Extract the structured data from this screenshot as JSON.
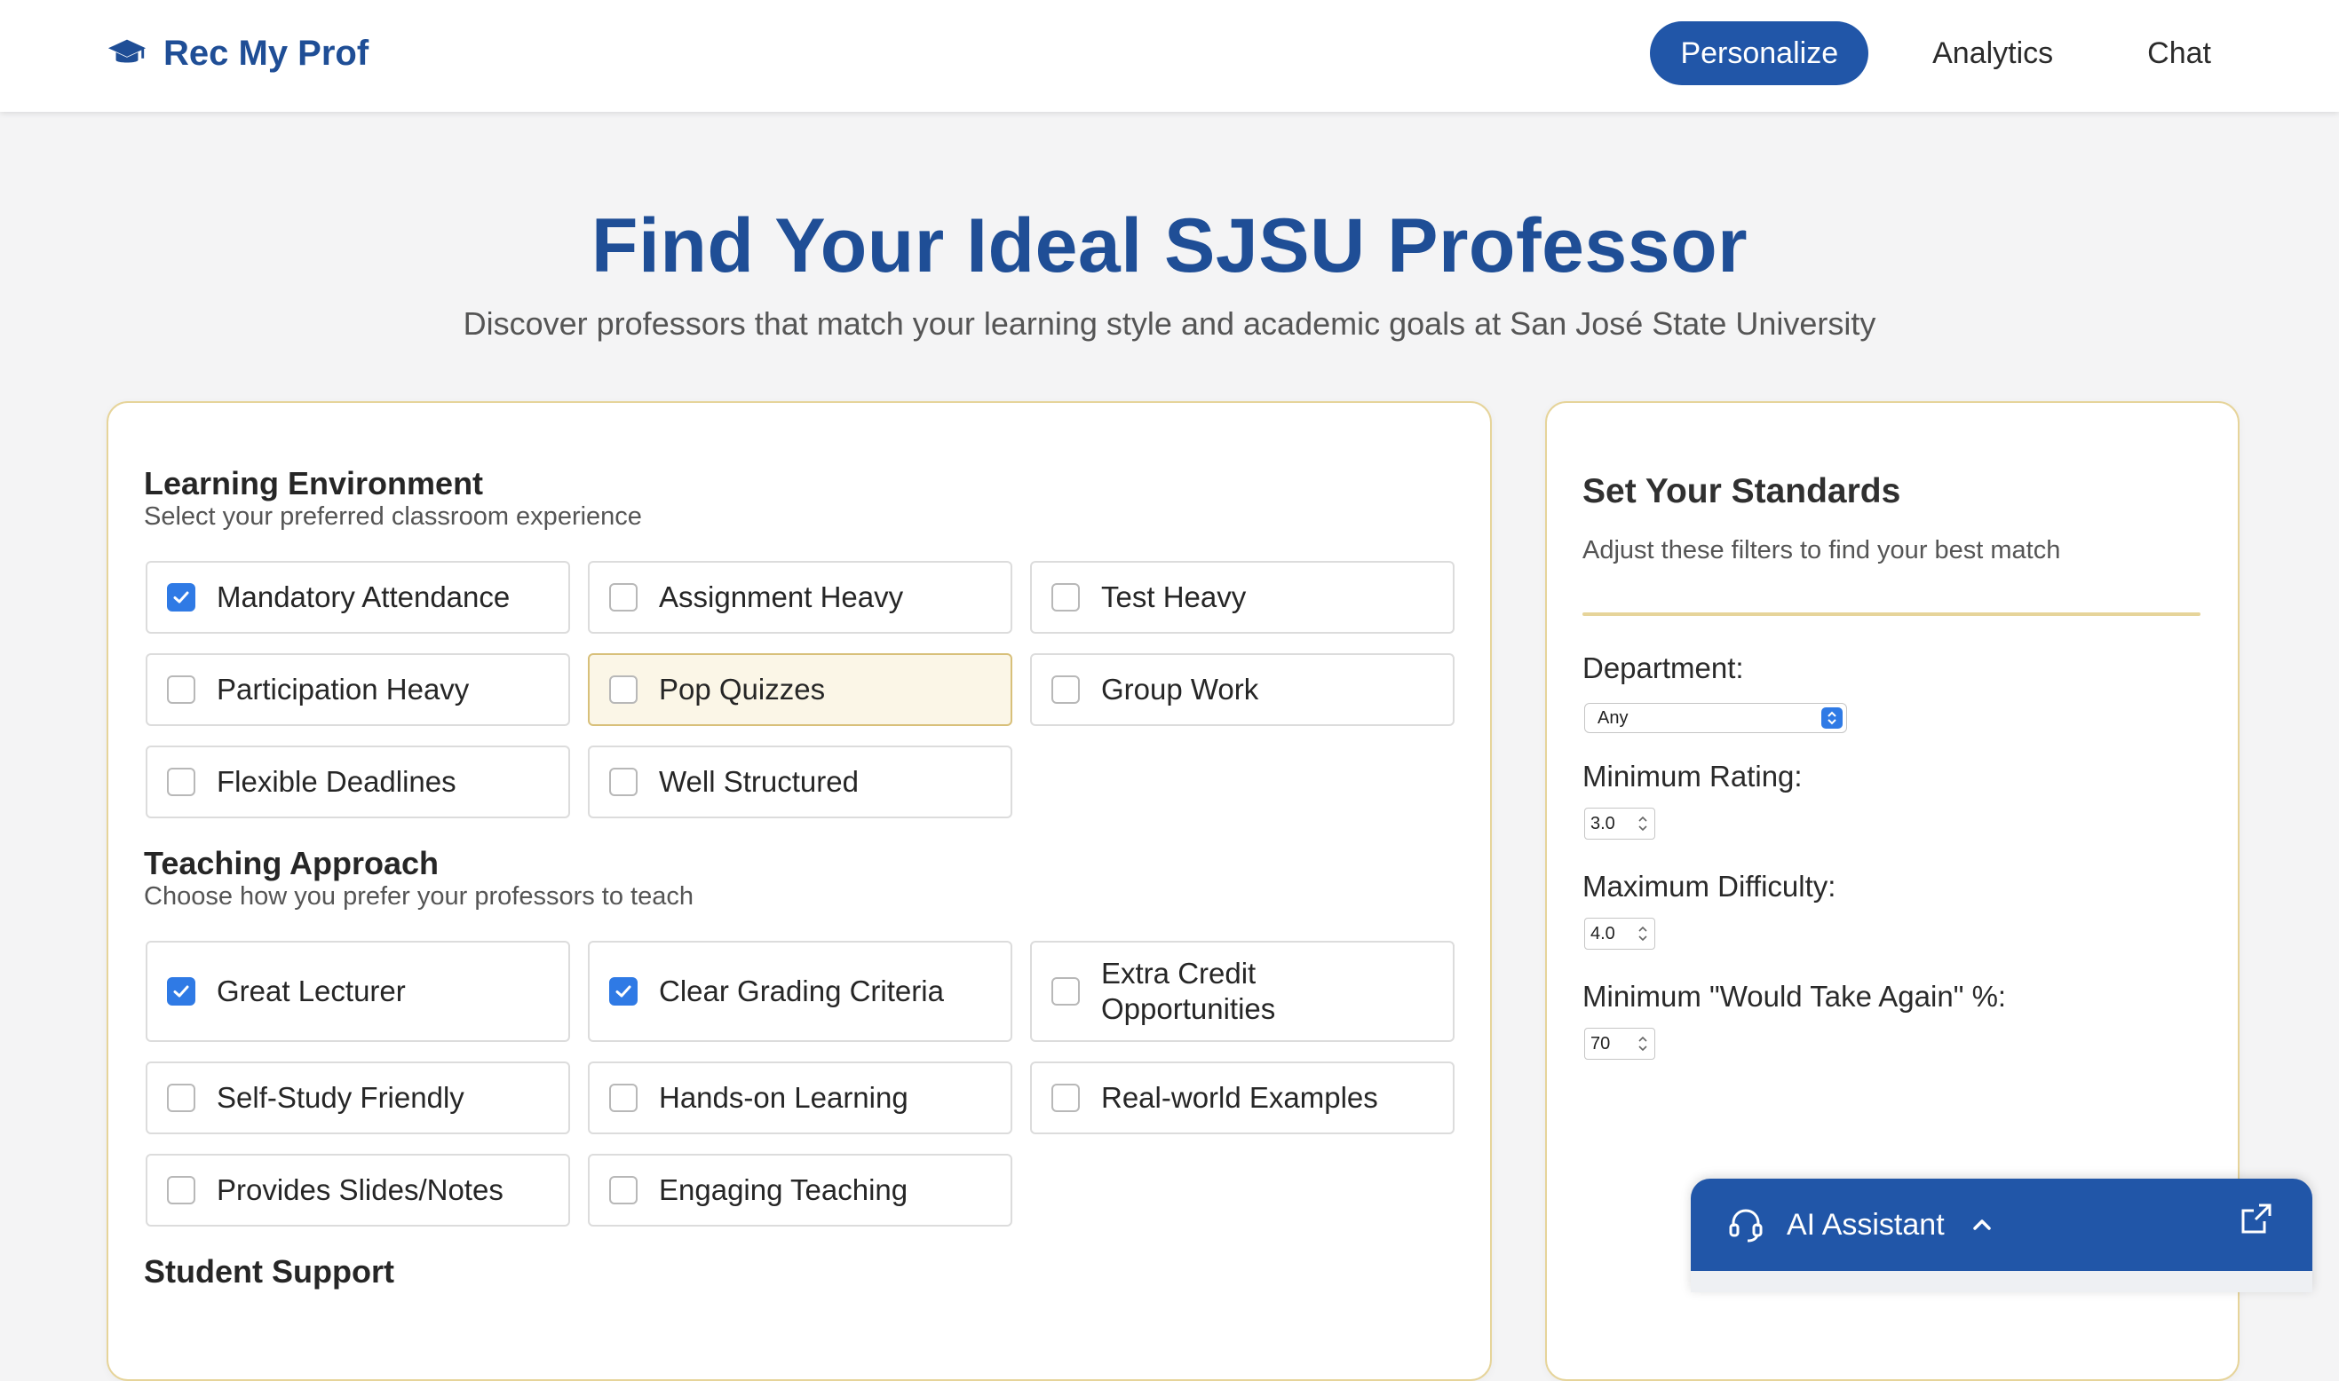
{
  "nav": {
    "brand": "Rec My Prof",
    "links": [
      {
        "label": "Personalize",
        "active": true
      },
      {
        "label": "Analytics",
        "active": false
      },
      {
        "label": "Chat",
        "active": false
      }
    ]
  },
  "hero": {
    "title": "Find Your Ideal SJSU Professor",
    "subtitle": "Discover professors that match your learning style and academic goals at San José State University"
  },
  "sections": [
    {
      "title": "Learning Environment",
      "subtitle": "Select your preferred classroom experience",
      "options": [
        {
          "label": "Mandatory Attendance",
          "checked": true,
          "highlighted": false
        },
        {
          "label": "Assignment Heavy",
          "checked": false,
          "highlighted": false
        },
        {
          "label": "Test Heavy",
          "checked": false,
          "highlighted": false
        },
        {
          "label": "Participation Heavy",
          "checked": false,
          "highlighted": false
        },
        {
          "label": "Pop Quizzes",
          "checked": false,
          "highlighted": true
        },
        {
          "label": "Group Work",
          "checked": false,
          "highlighted": false
        },
        {
          "label": "Flexible Deadlines",
          "checked": false,
          "highlighted": false
        },
        {
          "label": "Well Structured",
          "checked": false,
          "highlighted": false
        }
      ]
    },
    {
      "title": "Teaching Approach",
      "subtitle": "Choose how you prefer your professors to teach",
      "options": [
        {
          "label": "Great Lecturer",
          "checked": true,
          "highlighted": false
        },
        {
          "label": "Clear Grading Criteria",
          "checked": true,
          "highlighted": false
        },
        {
          "label": "Extra Credit Opportunities",
          "checked": false,
          "highlighted": false
        },
        {
          "label": "Self-Study Friendly",
          "checked": false,
          "highlighted": false
        },
        {
          "label": "Hands-on Learning",
          "checked": false,
          "highlighted": false
        },
        {
          "label": "Real-world Examples",
          "checked": false,
          "highlighted": false
        },
        {
          "label": "Provides Slides/Notes",
          "checked": false,
          "highlighted": false
        },
        {
          "label": "Engaging Teaching",
          "checked": false,
          "highlighted": false
        }
      ]
    },
    {
      "title": "Student Support",
      "subtitle": "",
      "options": []
    }
  ],
  "standards": {
    "title": "Set Your Standards",
    "subtitle": "Adjust these filters to find your best match",
    "department_label": "Department:",
    "department_value": "Any",
    "min_rating_label": "Minimum Rating:",
    "min_rating_value": "3.0",
    "max_difficulty_label": "Maximum Difficulty:",
    "max_difficulty_value": "4.0",
    "would_take_again_label": "Minimum \"Would Take Again\" %:",
    "would_take_again_value": "70"
  },
  "assistant": {
    "label": "AI Assistant"
  },
  "colors": {
    "brand": "#1f4e96",
    "accent": "#2156a8",
    "checkbox": "#2f7ae5",
    "card_border": "#e6d49a",
    "highlight_bg": "#fbf6e7"
  },
  "icons": {
    "brand": "graduation-cap-icon",
    "assistant": "headset-icon",
    "chevron": "chevron-up-icon",
    "external": "external-link-icon"
  }
}
